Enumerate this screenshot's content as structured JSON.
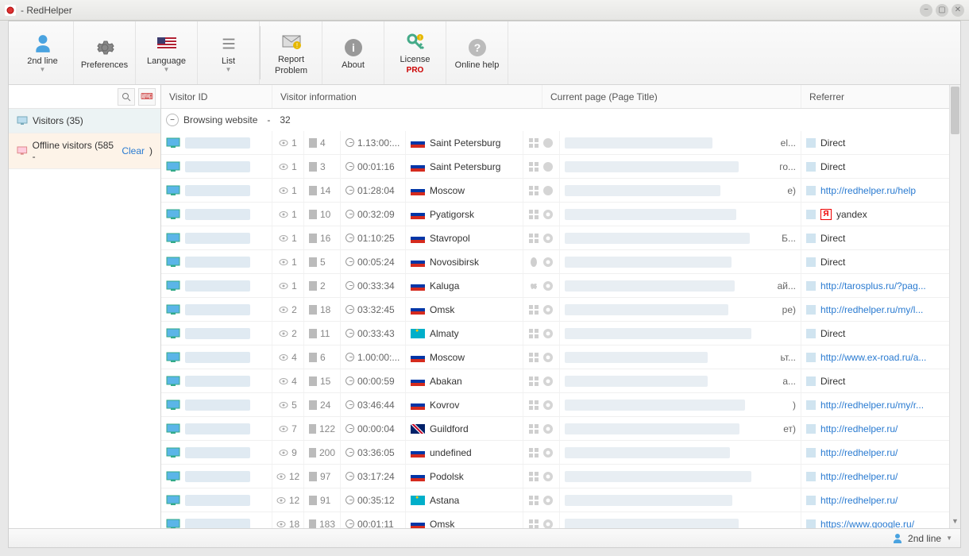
{
  "window": {
    "title": "- RedHelper"
  },
  "toolbar": {
    "second_line": "2nd line",
    "preferences": "Preferences",
    "language": "Language",
    "list": "List",
    "report_problem_l1": "Report",
    "report_problem_l2": "Problem",
    "about": "About",
    "license": "License",
    "license_sub": "PRO",
    "online_help": "Online help"
  },
  "sidebar": {
    "visitors_label": "Visitors (35)",
    "offline_label_prefix": "Offline visitors (585 - ",
    "offline_clear": "Clear",
    "offline_label_suffix": " )"
  },
  "columns": {
    "visitor_id": "Visitor ID",
    "visitor_info": "Visitor information",
    "current_page": "Current page (Page Title)",
    "referrer": "Referrer"
  },
  "group": {
    "label": "Browsing website",
    "sep": "-",
    "count": "32"
  },
  "statusbar": {
    "label": "2nd line"
  },
  "rows": [
    {
      "views": "1",
      "pages": "4",
      "time": "1.13:00:...",
      "flag": "ru",
      "loc": "Saint Petersburg",
      "os": "win",
      "br": "ff",
      "page_tail": "el...",
      "refer_type": "text",
      "refer": "Direct"
    },
    {
      "views": "1",
      "pages": "3",
      "time": "00:01:16",
      "flag": "ru",
      "loc": "Saint Petersburg",
      "os": "win",
      "br": "ff",
      "page_tail": "го...",
      "refer_type": "text",
      "refer": "Direct"
    },
    {
      "views": "1",
      "pages": "14",
      "time": "01:28:04",
      "flag": "ru",
      "loc": "Moscow",
      "os": "win",
      "br": "ff",
      "page_tail": "е)",
      "refer_type": "link",
      "refer": "http://redhelper.ru/help"
    },
    {
      "views": "1",
      "pages": "10",
      "time": "00:32:09",
      "flag": "ru",
      "loc": "Pyatigorsk",
      "os": "win",
      "br": "ch",
      "page_tail": "",
      "refer_type": "yandex",
      "refer": "yandex"
    },
    {
      "views": "1",
      "pages": "16",
      "time": "01:10:25",
      "flag": "ru",
      "loc": "Stavropol",
      "os": "win",
      "br": "ch",
      "page_tail": "Б...",
      "refer_type": "text",
      "refer": "Direct"
    },
    {
      "views": "1",
      "pages": "5",
      "time": "00:05:24",
      "flag": "ru",
      "loc": "Novosibirsk",
      "os": "linux",
      "br": "ch",
      "page_tail": "",
      "refer_type": "text",
      "refer": "Direct"
    },
    {
      "views": "1",
      "pages": "2",
      "time": "00:33:34",
      "flag": "ru",
      "loc": "Kaluga",
      "os": "mac",
      "br": "ch",
      "page_tail": "ай...",
      "refer_type": "link",
      "refer": "http://tarosplus.ru/?pag..."
    },
    {
      "views": "2",
      "pages": "18",
      "time": "03:32:45",
      "flag": "ru",
      "loc": "Omsk",
      "os": "win",
      "br": "ch",
      "page_tail": "ре)",
      "refer_type": "link",
      "refer": "http://redhelper.ru/my/l..."
    },
    {
      "views": "2",
      "pages": "11",
      "time": "00:33:43",
      "flag": "kz",
      "loc": "Almaty",
      "os": "win",
      "br": "ch",
      "page_tail": "",
      "refer_type": "text",
      "refer": "Direct"
    },
    {
      "views": "4",
      "pages": "6",
      "time": "1.00:00:...",
      "flag": "ru",
      "loc": "Moscow",
      "os": "win",
      "br": "ch",
      "page_tail": "ьт...",
      "refer_type": "link",
      "refer": "http://www.ex-road.ru/a..."
    },
    {
      "views": "4",
      "pages": "15",
      "time": "00:00:59",
      "flag": "ru",
      "loc": "Abakan",
      "os": "win",
      "br": "ch",
      "page_tail": "а...",
      "refer_type": "text",
      "refer": "Direct"
    },
    {
      "views": "5",
      "pages": "24",
      "time": "03:46:44",
      "flag": "ru",
      "loc": "Kovrov",
      "os": "win",
      "br": "ch",
      "page_tail": ")",
      "refer_type": "link",
      "refer": "http://redhelper.ru/my/r..."
    },
    {
      "views": "7",
      "pages": "122",
      "time": "00:00:04",
      "flag": "gb",
      "loc": "Guildford",
      "os": "win",
      "br": "ch",
      "page_tail": "ет)",
      "refer_type": "link",
      "refer": "http://redhelper.ru/"
    },
    {
      "views": "9",
      "pages": "200",
      "time": "03:36:05",
      "flag": "ru",
      "loc": "undefined",
      "os": "win",
      "br": "ch",
      "page_tail": "",
      "refer_type": "link",
      "refer": "http://redhelper.ru/"
    },
    {
      "views": "12",
      "pages": "97",
      "time": "03:17:24",
      "flag": "ru",
      "loc": "Podolsk",
      "os": "win",
      "br": "ch",
      "page_tail": "",
      "refer_type": "link",
      "refer": "http://redhelper.ru/"
    },
    {
      "views": "12",
      "pages": "91",
      "time": "00:35:12",
      "flag": "kz",
      "loc": "Astana",
      "os": "win",
      "br": "ch",
      "page_tail": "",
      "refer_type": "link",
      "refer": "http://redhelper.ru/"
    },
    {
      "views": "18",
      "pages": "183",
      "time": "00:01:11",
      "flag": "ru",
      "loc": "Omsk",
      "os": "win",
      "br": "ch",
      "page_tail": "",
      "refer_type": "link",
      "refer": "https://www.google.ru/"
    }
  ]
}
